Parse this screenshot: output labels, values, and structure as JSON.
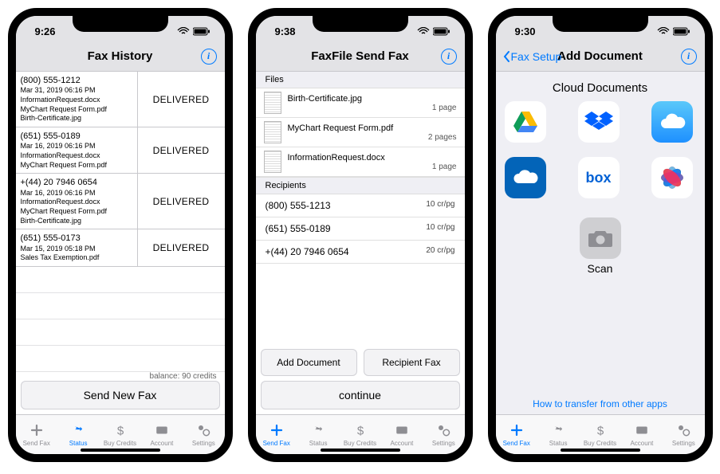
{
  "screen1": {
    "time": "9:26",
    "title": "Fax History",
    "history": [
      {
        "number": "(800) 555-1212",
        "date": "Mar 31, 2019 06:16 PM",
        "files": [
          "InformationRequest.docx",
          "MyChart Request Form.pdf",
          "Birth-Certificate.jpg"
        ],
        "status": "DELIVERED"
      },
      {
        "number": "(651) 555-0189",
        "date": "Mar 16, 2019 06:16 PM",
        "files": [
          "InformationRequest.docx",
          "MyChart Request Form.pdf"
        ],
        "status": "DELIVERED"
      },
      {
        "number": "+(44) 20 7946 0654",
        "date": "Mar 16, 2019 06:16 PM",
        "files": [
          "InformationRequest.docx",
          "MyChart Request Form.pdf",
          "Birth-Certificate.jpg"
        ],
        "status": "DELIVERED"
      },
      {
        "number": "(651) 555-0173",
        "date": "Mar 15, 2019 05:18 PM",
        "files": [
          "Sales Tax Exemption.pdf"
        ],
        "status": "DELIVERED"
      }
    ],
    "balance": "balance: 90 credits",
    "send_new": "Send New Fax"
  },
  "screen2": {
    "time": "9:38",
    "title": "FaxFile Send Fax",
    "files_header": "Files",
    "files": [
      {
        "name": "Birth-Certificate.jpg",
        "pages": "1 page"
      },
      {
        "name": "MyChart Request Form.pdf",
        "pages": "2 pages"
      },
      {
        "name": "InformationRequest.docx",
        "pages": "1 page"
      }
    ],
    "recipients_header": "Recipients",
    "recipients": [
      {
        "number": "(800) 555-1213",
        "rate": "10 cr/pg"
      },
      {
        "number": "(651) 555-0189",
        "rate": "10 cr/pg"
      },
      {
        "number": "+(44) 20 7946 0654",
        "rate": "20 cr/pg"
      }
    ],
    "add_doc": "Add Document",
    "recip_fax": "Recipient Fax",
    "continue": "continue"
  },
  "screen3": {
    "time": "9:30",
    "back": "Fax Setup",
    "title": "Add Document",
    "cloud_title": "Cloud Documents",
    "scan": "Scan",
    "link": "How to transfer from other apps",
    "providers": [
      "google-drive",
      "dropbox",
      "icloud",
      "onedrive",
      "box",
      "photos"
    ]
  },
  "tabs": {
    "send": "Send Fax",
    "status": "Status",
    "buy": "Buy Credits",
    "account": "Account",
    "settings": "Settings"
  }
}
